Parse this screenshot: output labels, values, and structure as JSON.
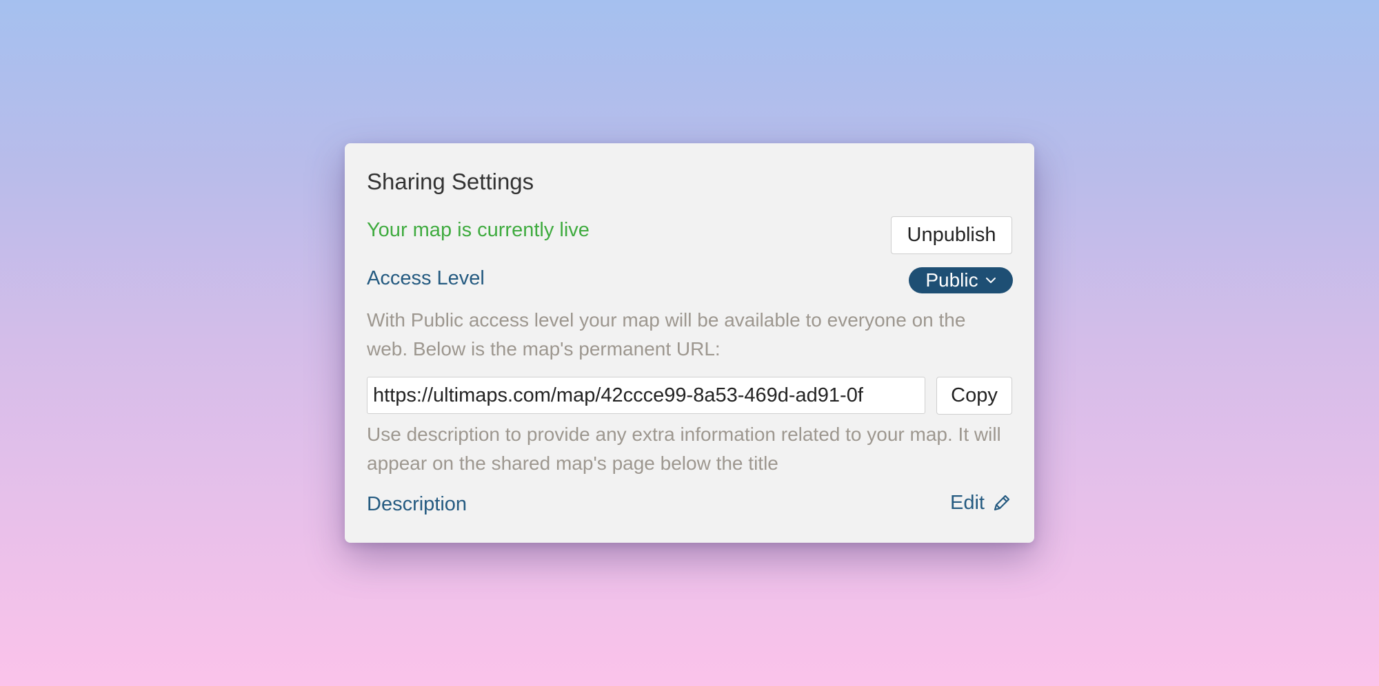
{
  "panel": {
    "title": "Sharing Settings",
    "status_text": "Your map is currently live",
    "status_color": "#3fab3f",
    "unpublish_label": "Unpublish",
    "access": {
      "label": "Access Level",
      "selected": "Public",
      "help": "With Public access level your map will be available to everyone on the web. Below is the map's permanent URL:",
      "pill_color": "#1e4f74"
    },
    "url": {
      "value": "https://ultimaps.com/map/42ccce99-8a53-469d-ad91-0f",
      "copy_label": "Copy"
    },
    "description": {
      "help": "Use description to provide any extra information related to your map. It will appear on the shared map's page below the title",
      "label": "Description",
      "edit_label": "Edit"
    },
    "icons": {
      "dropdown": "chevron-down-icon",
      "edit": "pencil-icon"
    },
    "colors": {
      "link": "#245a80",
      "muted_text": "#9d978f"
    }
  }
}
